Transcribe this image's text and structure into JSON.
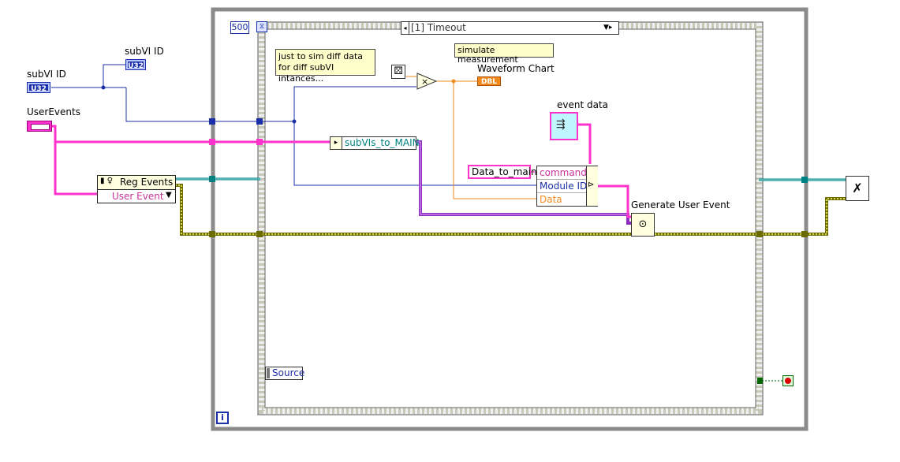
{
  "labels": {
    "subvi_id_top": "subVI ID",
    "subvi_id_left": "subVI ID",
    "user_events": "UserEvents",
    "waveform_chart": "Waveform Chart",
    "event_data": "event data",
    "generate_user_event": "Generate User Event"
  },
  "terminals": {
    "u32": "U32",
    "dbl": "DBL"
  },
  "while_loop": {
    "timeout_value": "500",
    "iteration": "i"
  },
  "event_structure": {
    "case_selector": "[1] Timeout",
    "source": "Source"
  },
  "comments": {
    "sim_data": "just to sim diff data for diff subVI intances...",
    "simulate": "simulate measurement"
  },
  "reg_events": {
    "title": "Reg Events",
    "item": "User Event"
  },
  "constants": {
    "data_to_main": "Data_to_main",
    "subvis_to_main": "subVIs_to_MAIN"
  },
  "bundle": {
    "fields": [
      "command",
      "Module ID",
      "Data"
    ]
  },
  "colors": {
    "wire_u32": "#1a2fa8",
    "wire_refnum": "#008080",
    "wire_error": "#6b6b00",
    "wire_string": "#ff33cc",
    "wire_dbl": "#f18a1d",
    "wire_cluster": "#8b2dbd"
  },
  "icons": {
    "random": "dice-icon",
    "multiply": "multiply-icon",
    "unregister": "unregister-events-icon",
    "stop": "stop-button-icon"
  }
}
